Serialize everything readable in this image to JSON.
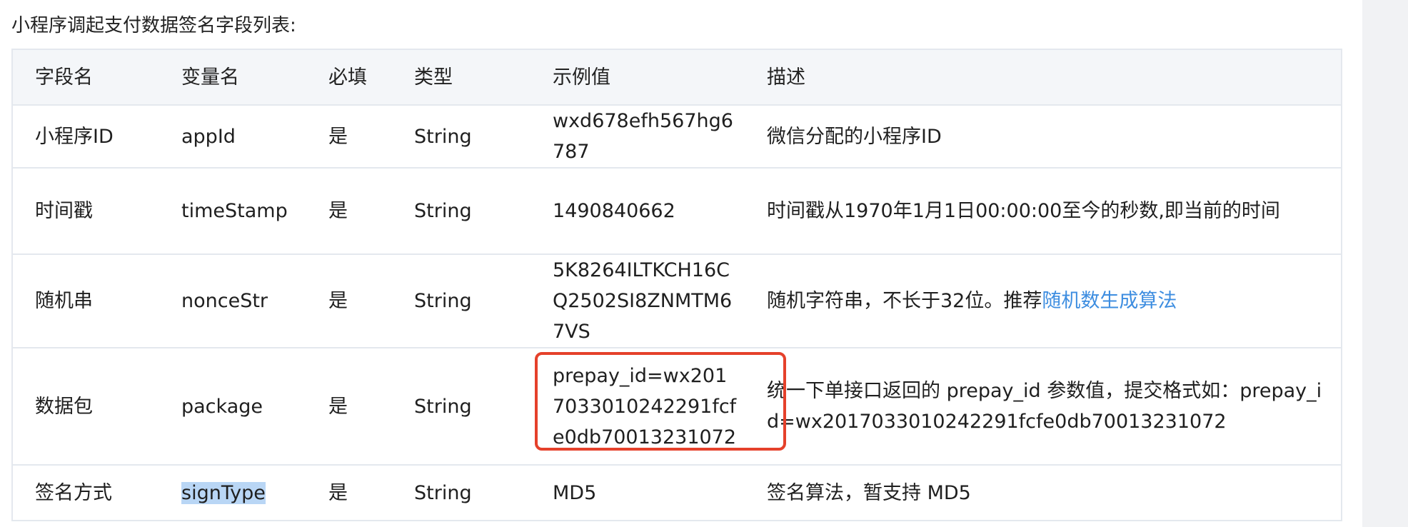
{
  "heading": "小程序调起支付数据签名字段列表:",
  "table": {
    "headers": {
      "field_name": "字段名",
      "variable": "变量名",
      "required": "必填",
      "type": "类型",
      "example": "示例值",
      "description": "描述"
    },
    "rows": [
      {
        "field_name": "小程序ID",
        "variable": "appId",
        "required": "是",
        "type": "String",
        "example": "wxd678efh567hg6787",
        "description": "微信分配的小程序ID"
      },
      {
        "field_name": "时间戳",
        "variable": "timeStamp",
        "required": "是",
        "type": "String",
        "example": "1490840662",
        "description": "时间戳从1970年1月1日00:00:00至今的秒数,即当前的时间"
      },
      {
        "field_name": "随机串",
        "variable": "nonceStr",
        "required": "是",
        "type": "String",
        "example": "5K8264ILTKCH16CQ2502SI8ZNMTM67VS",
        "description": "随机字符串，不长于32位。推荐",
        "description_link": "随机数生成算法"
      },
      {
        "field_name": "数据包",
        "variable": "package",
        "required": "是",
        "type": "String",
        "example": "prepay_id=wx2017033010242291fcfe0db70013231072",
        "description": "统一下单接口返回的 prepay_id 参数值，提交格式如：prepay_id=wx2017033010242291fcfe0db70013231072"
      },
      {
        "field_name": "签名方式",
        "variable": "signType",
        "required": "是",
        "type": "String",
        "example": "MD5",
        "description": "签名算法，暂支持 MD5"
      }
    ]
  },
  "colors": {
    "link": "#3d8de0",
    "highlight": "#b9d6f5",
    "annotation_box": "#e5412b",
    "header_bg": "#f4f6f9",
    "border": "#e4e8ee"
  }
}
